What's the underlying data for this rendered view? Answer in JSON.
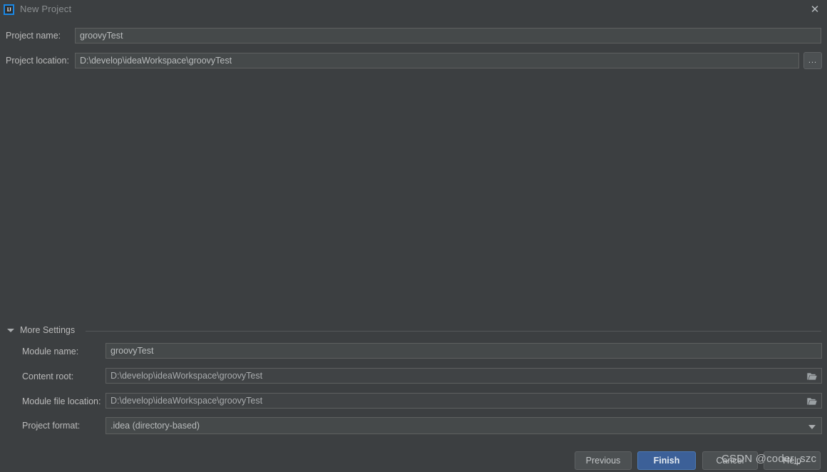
{
  "window": {
    "title": "New Project",
    "app_icon": "IJ",
    "close_icon": "✕"
  },
  "top_form": {
    "project_name": {
      "label": "Project name:",
      "value": "groovyTest"
    },
    "project_location": {
      "label": "Project location:",
      "value": "D:\\develop\\ideaWorkspace\\groovyTest",
      "browse_button": "..."
    }
  },
  "more_settings": {
    "label": "More Settings",
    "expanded": true,
    "fields": [
      {
        "label": "Module name:",
        "value": "groovyTest",
        "has_folder_icon": false
      },
      {
        "label": "Content root:",
        "value": "D:\\develop\\ideaWorkspace\\groovyTest",
        "has_folder_icon": true
      },
      {
        "label": "Module file location:",
        "value": "D:\\develop\\ideaWorkspace\\groovyTest",
        "has_folder_icon": true
      }
    ],
    "project_format": {
      "label": "Project format:",
      "value": ".idea (directory-based)"
    }
  },
  "footer": {
    "previous": "Previous",
    "finish": "Finish",
    "cancel": "Cancel",
    "help": "Help"
  },
  "watermark": {
    "text": "CSDN @coder_szc"
  },
  "colors": {
    "background": "#3c3f41",
    "field_background": "#45494a",
    "field_border": "#5e6060",
    "primary_button": "#3c6098",
    "accent": "#1a87e4",
    "text": "#bbbbbb"
  }
}
